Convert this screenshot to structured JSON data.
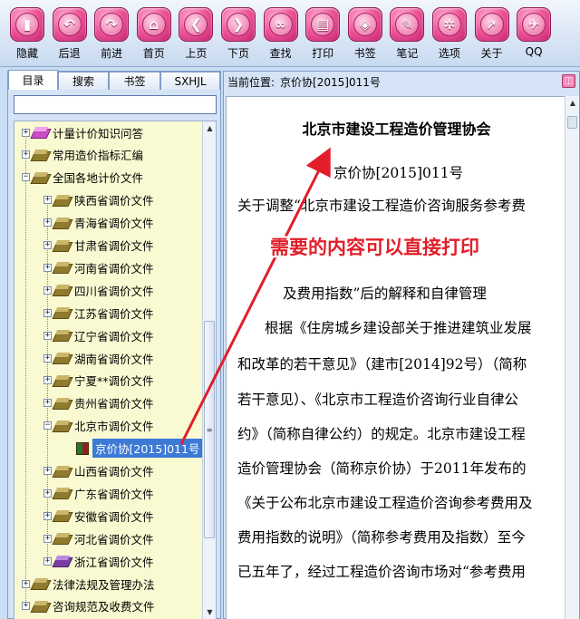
{
  "toolbar": {
    "buttons": [
      {
        "label": "隐藏",
        "icon": "hide-icon",
        "glyph": "▮"
      },
      {
        "label": "后退",
        "icon": "back-arrow-icon",
        "glyph": "↶"
      },
      {
        "label": "前进",
        "icon": "forward-arrow-icon",
        "glyph": "↷"
      },
      {
        "label": "首页",
        "icon": "home-icon",
        "glyph": "⌂"
      },
      {
        "label": "上页",
        "icon": "prev-page-icon",
        "glyph": "❮"
      },
      {
        "label": "下页",
        "icon": "next-page-icon",
        "glyph": "❯"
      },
      {
        "label": "查找",
        "icon": "binoculars-icon",
        "glyph": "∞"
      },
      {
        "label": "打印",
        "icon": "printer-icon",
        "glyph": "▤"
      },
      {
        "label": "书签",
        "icon": "bookmark-tag-icon",
        "glyph": "◈"
      },
      {
        "label": "笔记",
        "icon": "note-icon",
        "glyph": "✎"
      },
      {
        "label": "选项",
        "icon": "gear-icon",
        "glyph": "✲"
      },
      {
        "label": "关于",
        "icon": "cursor-icon",
        "glyph": "➚"
      },
      {
        "label": "QQ",
        "icon": "qq-icon",
        "glyph": "✈"
      }
    ]
  },
  "sidebar": {
    "tabs": [
      "目录",
      "搜索",
      "书签",
      "SXHJL"
    ],
    "search_value": "",
    "tree": [
      {
        "label": "计量计价知识问答",
        "depth": 0,
        "expander": "+",
        "icon": "pink"
      },
      {
        "label": "常用造价指标汇编",
        "depth": 0,
        "expander": "+",
        "icon": "book"
      },
      {
        "label": "全国各地计价文件",
        "depth": 0,
        "expander": "−",
        "icon": "book"
      },
      {
        "label": "陕西省调价文件",
        "depth": 1,
        "expander": "+",
        "icon": "book"
      },
      {
        "label": "青海省调价文件",
        "depth": 1,
        "expander": "+",
        "icon": "book"
      },
      {
        "label": "甘肃省调价文件",
        "depth": 1,
        "expander": "+",
        "icon": "book"
      },
      {
        "label": "河南省调价文件",
        "depth": 1,
        "expander": "+",
        "icon": "book"
      },
      {
        "label": "四川省调价文件",
        "depth": 1,
        "expander": "+",
        "icon": "book"
      },
      {
        "label": "江苏省调价文件",
        "depth": 1,
        "expander": "+",
        "icon": "book"
      },
      {
        "label": "辽宁省调价文件",
        "depth": 1,
        "expander": "+",
        "icon": "book"
      },
      {
        "label": "湖南省调价文件",
        "depth": 1,
        "expander": "+",
        "icon": "book"
      },
      {
        "label": "宁夏**调价文件",
        "depth": 1,
        "expander": "+",
        "icon": "book"
      },
      {
        "label": "贵州省调价文件",
        "depth": 1,
        "expander": "+",
        "icon": "book"
      },
      {
        "label": "北京市调价文件",
        "depth": 1,
        "expander": "−",
        "icon": "book"
      },
      {
        "label": "京价协[2015]011号",
        "depth": 2,
        "expander": "",
        "icon": "doc",
        "selected": true
      },
      {
        "label": "山西省调价文件",
        "depth": 1,
        "expander": "+",
        "icon": "book"
      },
      {
        "label": "广东省调价文件",
        "depth": 1,
        "expander": "+",
        "icon": "book"
      },
      {
        "label": "安徽省调价文件",
        "depth": 1,
        "expander": "+",
        "icon": "book"
      },
      {
        "label": "河北省调价文件",
        "depth": 1,
        "expander": "+",
        "icon": "book"
      },
      {
        "label": "浙江省调价文件",
        "depth": 1,
        "expander": "+",
        "icon": "purple"
      },
      {
        "label": "法律法规及管理办法",
        "depth": 0,
        "expander": "+",
        "icon": "book"
      },
      {
        "label": "咨询规范及收费文件",
        "depth": 0,
        "expander": "+",
        "icon": "book"
      }
    ]
  },
  "location": {
    "label": "当前位置:",
    "value": "京价协[2015]011号"
  },
  "document": {
    "title": "北京市建设工程造价管理协会",
    "doc_number": "京价协[2015]011号",
    "lines": [
      "关于调整“北京市建设工程造价咨询服务参考费",
      "及费用指数”后的解释和自律管理",
      "根据《住房城乡建设部关于推进建筑业发展",
      "和改革的若干意见》（建市[2014]92号）（简称",
      "若干意见）、《北京市工程造价咨询行业自律公",
      "约》（简称自律公约）的规定。北京市建设工程",
      "造价管理协会（简称京价协）于2011年发布的",
      "《关于公布北京市建设工程造价咨询参考费用及",
      "费用指数的说明》（简称参考费用及指数）至今",
      "已五年了，经过工程造价咨询市场对“参考费用"
    ]
  },
  "annotation": {
    "callout_text": "需要的内容可以直接打印",
    "color": "#e11e2a"
  },
  "colors": {
    "toolbar_icon": "#f05a9d",
    "tree_background": "#fafad2",
    "selection": "#3c7ad6",
    "panel_background": "#d4e3f5"
  }
}
